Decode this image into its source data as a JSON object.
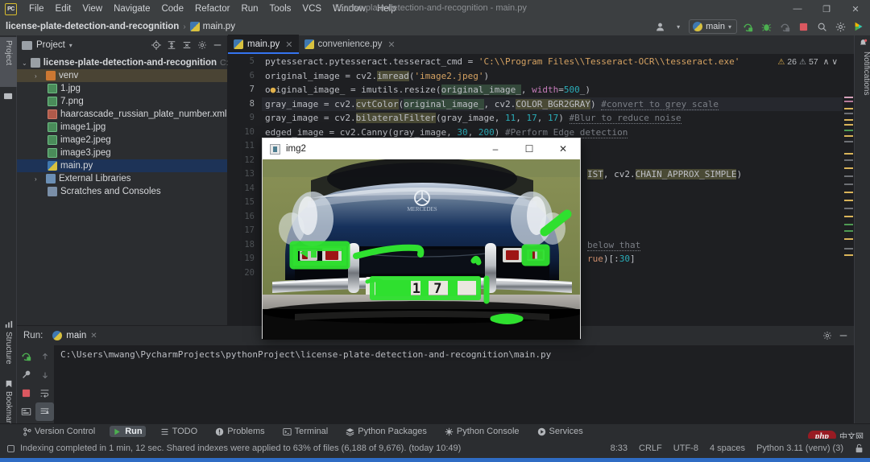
{
  "window": {
    "title": "license-plate-detection-and-recognition - main.py",
    "minimize": "—",
    "maximize": "❐",
    "close": "✕"
  },
  "menubar": {
    "items": [
      "File",
      "Edit",
      "View",
      "Navigate",
      "Code",
      "Refactor",
      "Run",
      "Tools",
      "VCS",
      "Window",
      "Help"
    ]
  },
  "breadcrumb": {
    "project": "license-plate-detection-and-recognition",
    "separator": "›",
    "file": "main.py"
  },
  "toolbar": {
    "run_config": "main",
    "dropdown_caret": "▾",
    "icons": [
      "user-icon",
      "run-icon",
      "debug-icon",
      "coverage-icon",
      "stop-icon",
      "search-icon",
      "settings-icon",
      "ai-icon"
    ]
  },
  "left_strip": {
    "project_label": "Project",
    "structure_label": "Structure",
    "bookmarks_label": "Bookmarks"
  },
  "right_strip": {
    "notifications_label": "Notifications"
  },
  "project_panel": {
    "header": "Project",
    "caret": "▾",
    "actions": [
      "locate-icon",
      "expand-all-icon",
      "collapse-all-icon",
      "settings-icon",
      "hide-icon"
    ],
    "tree": [
      {
        "label": "license-plate-detection-and-recognition",
        "suffix": "C:\\Users\\m",
        "icon": "folder-icon",
        "indent": 0,
        "arrow": "⌄",
        "bold": true,
        "state": "normal"
      },
      {
        "label": "venv",
        "suffix": "",
        "icon": "folder-orange-icon",
        "indent": 1,
        "arrow": "›",
        "bold": false,
        "state": "venv"
      },
      {
        "label": "1.jpg",
        "suffix": "",
        "icon": "image-file-icon",
        "indent": 2,
        "arrow": "",
        "bold": false,
        "state": "normal"
      },
      {
        "label": "7.png",
        "suffix": "",
        "icon": "image-file-icon",
        "indent": 2,
        "arrow": "",
        "bold": false,
        "state": "normal"
      },
      {
        "label": "haarcascade_russian_plate_number.xml",
        "suffix": "",
        "icon": "xml-file-icon",
        "indent": 2,
        "arrow": "",
        "bold": false,
        "state": "normal"
      },
      {
        "label": "image1.jpg",
        "suffix": "",
        "icon": "image-file-icon",
        "indent": 2,
        "arrow": "",
        "bold": false,
        "state": "normal"
      },
      {
        "label": "image2.jpeg",
        "suffix": "",
        "icon": "image-file-icon",
        "indent": 2,
        "arrow": "",
        "bold": false,
        "state": "normal"
      },
      {
        "label": "image3.jpeg",
        "suffix": "",
        "icon": "image-file-icon",
        "indent": 2,
        "arrow": "",
        "bold": false,
        "state": "normal"
      },
      {
        "label": "main.py",
        "suffix": "",
        "icon": "python-file-icon",
        "indent": 2,
        "arrow": "",
        "bold": false,
        "state": "selected"
      },
      {
        "label": "External Libraries",
        "suffix": "",
        "icon": "library-icon",
        "indent": 0,
        "arrow": "›",
        "bold": false,
        "state": "normal"
      },
      {
        "label": "Scratches and Consoles",
        "suffix": "",
        "icon": "scratch-icon",
        "indent": 1,
        "arrow": "",
        "bold": false,
        "state": "normal"
      }
    ]
  },
  "editor": {
    "tabs": [
      {
        "label": "main.py",
        "active": true,
        "close": "✕"
      },
      {
        "label": "convenience.py",
        "active": false,
        "close": "✕"
      }
    ],
    "inspections": {
      "warning_count": "26",
      "weak_count": "57",
      "up": "∧",
      "down": "∨"
    },
    "line_numbers": [
      "5",
      "6",
      "7",
      "8",
      "9",
      "10",
      "11",
      "12",
      "13",
      "14",
      "15",
      "16",
      "17",
      "18",
      "19",
      "20"
    ],
    "lines": [
      {
        "n": "5",
        "text": "pytesseract.pytesseract.tesseract_cmd = 'C:\\\\Program Files\\\\Tesseract-OCR\\\\tesseract.exe'"
      },
      {
        "n": "6",
        "text": "original_image = cv2.imread('image2.jpeg')"
      },
      {
        "n": "7",
        "text": "original_image_ = imutils.resize(original_image_, width=500_)"
      },
      {
        "n": "8",
        "text": "gray_image = cv2.cvtColor(original_image_, cv2.COLOR_BGR2GRAY) #convert to grey scale"
      },
      {
        "n": "9",
        "text": "gray_image = cv2.bilateralFilter(gray_image, 11, 17, 17) #Blur to reduce noise"
      },
      {
        "n": "10",
        "text": "edged_image = cv2.Canny(gray_image, 30, 200) #Perform Edge detection"
      },
      {
        "n": "11",
        "text": ""
      },
      {
        "n": "12",
        "text": ""
      },
      {
        "n": "13",
        "text": "...IST, cv2.CHAIN_APPROX_SIMPLE)"
      },
      {
        "n": "14",
        "text": ""
      },
      {
        "n": "15",
        "text": ""
      },
      {
        "n": "16",
        "text": ""
      },
      {
        "n": "17",
        "text": ""
      },
      {
        "n": "18",
        "text": "... below that"
      },
      {
        "n": "19",
        "text": "...rue)[:30]"
      },
      {
        "n": "20",
        "text": ""
      }
    ]
  },
  "image_dialog": {
    "title": "img2",
    "minimize": "–",
    "maximize": "☐",
    "close": "✕",
    "image_description": "blue sports car front view with green contour detection overlays and license plate"
  },
  "run_panel": {
    "label": "Run:",
    "tab": "main",
    "close": "✕",
    "header_icons": [
      "settings-icon",
      "hide-icon"
    ],
    "tools": [
      "rerun-icon",
      "up-arrow-icon",
      "wrench-icon",
      "down-arrow-icon",
      "stop-icon",
      "soft-wrap-icon",
      "console-icon",
      "scroll-end-icon",
      "pin-icon",
      "print-icon",
      "trash-icon"
    ],
    "console_output": "C:\\Users\\mwang\\PycharmProjects\\pythonProject\\license-plate-detection-and-recognition\\main.py"
  },
  "bottom_tabs": [
    {
      "label": "Version Control",
      "icon": "branch-icon",
      "selected": false
    },
    {
      "label": "Run",
      "icon": "run-icon",
      "selected": true
    },
    {
      "label": "TODO",
      "icon": "todo-icon",
      "selected": false
    },
    {
      "label": "Problems",
      "icon": "problems-icon",
      "selected": false
    },
    {
      "label": "Terminal",
      "icon": "terminal-icon",
      "selected": false
    },
    {
      "label": "Python Packages",
      "icon": "packages-icon",
      "selected": false
    },
    {
      "label": "Python Console",
      "icon": "python-console-icon",
      "selected": false
    },
    {
      "label": "Services",
      "icon": "services-icon",
      "selected": false
    }
  ],
  "statusbar": {
    "message": "Indexing completed in 1 min, 12 sec. Shared indexes were applied to 63% of files (6,188 of 9,676). (today 10:49)",
    "caret_position": "8:33",
    "line_separator": "CRLF",
    "encoding": "UTF-8",
    "indent": "4 spaces",
    "interpreter": "Python 3.11 (venv) (3)",
    "lock_icon": "lock-icon"
  },
  "watermark": {
    "brand": "php",
    "suffix": "中文网"
  },
  "colors": {
    "accent": "#3574f0",
    "panel_bg": "#2b2d30",
    "editor_bg": "#1e1f22",
    "selection": "#1d3357",
    "status_blue": "#2f6cc4",
    "warning": "#e0b04b",
    "overlay_green": "#2fe02f"
  }
}
